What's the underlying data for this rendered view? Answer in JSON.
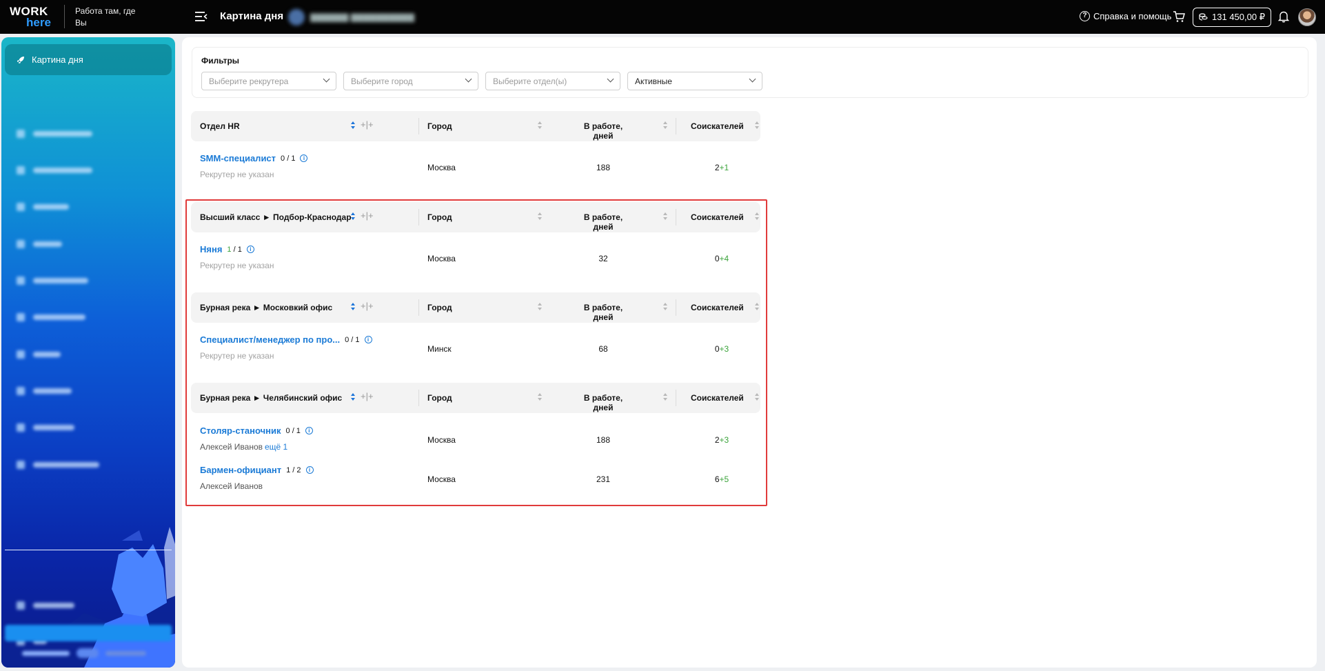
{
  "header": {
    "logo_top": "WORK",
    "logo_bottom": "here",
    "tagline": "Работа там, где Вы",
    "page_title": "Картина дня",
    "help_label": "Справка и помощь",
    "balance": "131 450,00 ₽"
  },
  "sidebar": {
    "active_item": "Картина дня"
  },
  "filters": {
    "label": "Фильтры",
    "recruiter_placeholder": "Выберите рекрутера",
    "city_placeholder": "Выберите город",
    "department_placeholder": "Выберите отдел(ы)",
    "status_value": "Активные"
  },
  "columns": {
    "city": "Город",
    "days": "В работе, дней",
    "candidates": "Соискателей"
  },
  "groups": [
    {
      "name": "Отдел HR",
      "rows": [
        {
          "title": "SMM-специалист",
          "count_done": "",
          "count": "0 / 1",
          "recruiter": "Рекрутер не указан",
          "recruiter_more": "",
          "city": "Москва",
          "days": "188",
          "cand": "2",
          "cand_plus": "+1"
        }
      ]
    },
    {
      "name": "Высший класс ► Подбор-Краснодар",
      "rows": [
        {
          "title": "Няня",
          "count_done": "1",
          "count": " / 1",
          "recruiter": "Рекрутер не указан",
          "recruiter_more": "",
          "city": "Москва",
          "days": "32",
          "cand": "0",
          "cand_plus": "+4"
        }
      ]
    },
    {
      "name": "Бурная река ► Московкий офис",
      "rows": [
        {
          "title": "Специалист/менеджер по про...",
          "count_done": "",
          "count": "0 / 1",
          "recruiter": "Рекрутер не указан",
          "recruiter_more": "",
          "city": "Минск",
          "days": "68",
          "cand": "0",
          "cand_plus": "+3"
        }
      ]
    },
    {
      "name": "Бурная река ► Челябинский офис",
      "rows": [
        {
          "title": "Столяр-станочник",
          "count_done": "",
          "count": "0 / 1",
          "recruiter": "Алексей Иванов",
          "recruiter_more": "ещё 1",
          "city": "Москва",
          "days": "188",
          "cand": "2",
          "cand_plus": "+3"
        },
        {
          "title": "Бармен-официант",
          "count_done": "",
          "count": "1 / 2",
          "recruiter": "Алексей Иванов",
          "recruiter_more": "",
          "city": "Москва",
          "days": "231",
          "cand": "6",
          "cand_plus": "+5"
        }
      ]
    }
  ],
  "colors": {
    "accent": "#1a7ad6",
    "positive": "#3aa33a",
    "highlight": "#e03a3a"
  }
}
